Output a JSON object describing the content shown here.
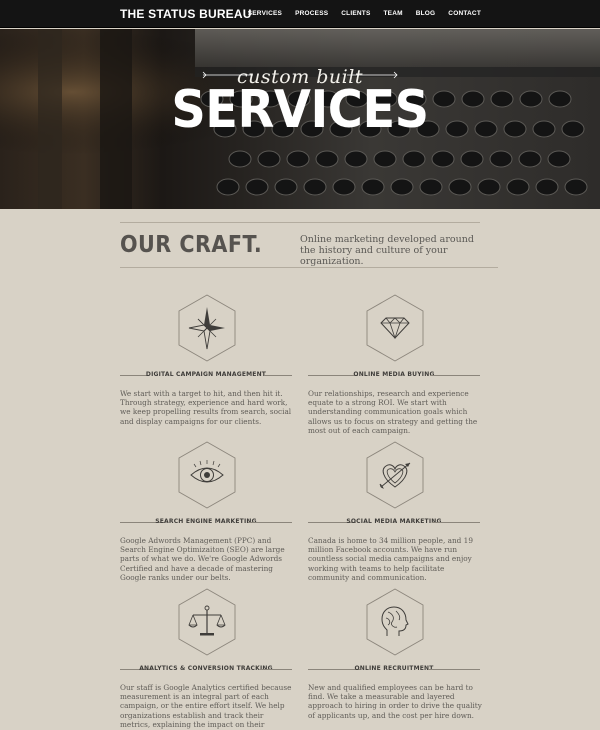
{
  "header": {
    "logo": "THE STATUS BUREAU",
    "nav": [
      "SERVICES",
      "PROCESS",
      "CLIENTS",
      "TEAM",
      "BLOG",
      "CONTACT"
    ]
  },
  "hero": {
    "subtitle": "custom built",
    "title": "SERVICES"
  },
  "craft": {
    "title": "OUR CRAFT.",
    "description": "Online marketing developed around the history and culture of your organization."
  },
  "services": [
    {
      "icon": "compass-rose-icon",
      "title": "DIGITAL CAMPAIGN MANAGEMENT",
      "description": "We start with a target to hit, and then hit it. Through strategy, experience and hard work, we keep propelling results from search, social and display campaigns for our clients."
    },
    {
      "icon": "diamond-icon",
      "title": "ONLINE MEDIA BUYING",
      "description": "Our relationships, research and experience equate to a strong ROI. We start with understanding communication goals which allows us to focus on strategy and getting the most out of each campaign."
    },
    {
      "icon": "eye-icon",
      "title": "SEARCH ENGINE MARKETING",
      "description": "Google Adwords Management (PPC) and Search Engine Optimizaiton (SEO) are large parts of what we do. We're Google Adwords Certified and have a decade of mastering Google ranks under our belts."
    },
    {
      "icon": "heart-arrow-icon",
      "title": "SOCIAL MEDIA MARKETING",
      "description": "Canada is home to 34 million people, and 19 million Facebook accounts. We have run countless social media campaigns and enjoy working with teams to help facilitate community and communication."
    },
    {
      "icon": "scales-icon",
      "title": "ANALYTICS & CONVERSION TRACKING",
      "description": "Our staff is Google Analytics certified because measurement is an integral part of each campaign, or the entire effort itself. We help organizations establish and track their metrics, explaining the impact on their business."
    },
    {
      "icon": "head-profile-icon",
      "title": "ONLINE RECRUITMENT",
      "description": "New and qualified employees can be hard to find. We take a measurable and layered approach to hiring in order to drive the quality of applicants up, and the cost per hire down."
    }
  ]
}
